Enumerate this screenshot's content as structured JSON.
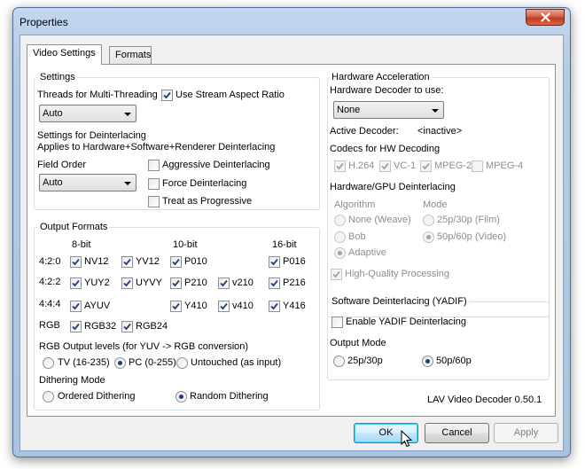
{
  "window": {
    "title": "Properties",
    "close_icon": "close-icon"
  },
  "tabs": [
    {
      "label": "Video Settings",
      "active": true
    },
    {
      "label": "Formats",
      "active": false
    }
  ],
  "settings": {
    "heading": "Settings",
    "threads_label": "Threads for Multi-Threading",
    "threads_value": "Auto",
    "stream_aspect": {
      "label": "Use Stream Aspect Ratio",
      "checked": true
    },
    "deint_heading": "Settings for Deinterlacing",
    "deint_sub": "Applies to Hardware+Software+Renderer Deinterlacing",
    "field_order_label": "Field Order",
    "field_order_value": "Auto",
    "aggressive": {
      "label": "Aggressive Deinterlacing",
      "checked": false
    },
    "force": {
      "label": "Force Deinterlacing",
      "checked": false
    },
    "progressive": {
      "label": "Treat as Progressive",
      "checked": false
    }
  },
  "output_formats": {
    "heading": "Output Formats",
    "col_headers": [
      "8-bit",
      "10-bit",
      "16-bit"
    ],
    "rows": [
      {
        "label": "4:2:0",
        "items": [
          {
            "label": "NV12",
            "checked": true
          },
          {
            "label": "YV12",
            "checked": true
          },
          {
            "label": "P010",
            "checked": true
          },
          {
            "label": "P016",
            "checked": true
          }
        ]
      },
      {
        "label": "4:2:2",
        "items": [
          {
            "label": "YUY2",
            "checked": true
          },
          {
            "label": "UYVY",
            "checked": true
          },
          {
            "label": "P210",
            "checked": true
          },
          {
            "label": "v210",
            "checked": true
          },
          {
            "label": "P216",
            "checked": true
          }
        ]
      },
      {
        "label": "4:4:4",
        "items": [
          {
            "label": "AYUV",
            "checked": true
          },
          {
            "label": "Y410",
            "checked": true
          },
          {
            "label": "v410",
            "checked": true
          },
          {
            "label": "Y416",
            "checked": true
          }
        ]
      },
      {
        "label": "RGB",
        "items": [
          {
            "label": "RGB32",
            "checked": true
          },
          {
            "label": "RGB24",
            "checked": true
          }
        ]
      }
    ],
    "rgb_levels_label": "RGB Output levels (for YUV -> RGB conversion)",
    "rgb_levels": [
      {
        "label": "TV (16-235)",
        "selected": false
      },
      {
        "label": "PC (0-255)",
        "selected": true
      },
      {
        "label": "Untouched (as input)",
        "selected": false
      }
    ],
    "dither_label": "Dithering Mode",
    "dither": [
      {
        "label": "Ordered Dithering",
        "selected": false
      },
      {
        "label": "Random Dithering",
        "selected": true
      }
    ]
  },
  "hw": {
    "heading": "Hardware Acceleration",
    "decoder_label": "Hardware Decoder to use:",
    "decoder_value": "None",
    "active_label": "Active Decoder:",
    "active_value": "<inactive>",
    "codecs_label": "Codecs for HW Decoding",
    "codecs": [
      {
        "label": "H.264",
        "checked": true
      },
      {
        "label": "VC-1",
        "checked": true
      },
      {
        "label": "MPEG-2",
        "checked": true
      },
      {
        "label": "MPEG-4",
        "checked": false
      }
    ],
    "deint_label": "Hardware/GPU Deinterlacing",
    "algo_label": "Algorithm",
    "mode_label": "Mode",
    "algos": [
      {
        "label": "None (Weave)",
        "selected": false
      },
      {
        "label": "Bob",
        "selected": false
      },
      {
        "label": "Adaptive",
        "selected": true
      }
    ],
    "modes": [
      {
        "label": "25p/30p (Film)",
        "selected": false
      },
      {
        "label": "50p/60p (Video)",
        "selected": true
      }
    ],
    "hq": {
      "label": "High-Quality Processing",
      "checked": true
    }
  },
  "sw": {
    "heading": "Software Deinterlacing (YADIF)",
    "enable": {
      "label": "Enable YADIF Deinterlacing",
      "checked": false
    },
    "output_mode_label": "Output Mode",
    "modes": [
      {
        "label": "25p/30p",
        "selected": false
      },
      {
        "label": "50p/60p",
        "selected": true
      }
    ]
  },
  "version": "LAV Video Decoder 0.50.1",
  "buttons": {
    "ok": "OK",
    "cancel": "Cancel",
    "apply": "Apply"
  },
  "colors": {
    "accent": "#1c3f7a",
    "titlebar": "#b2cbe8",
    "close": "#c0391f"
  }
}
